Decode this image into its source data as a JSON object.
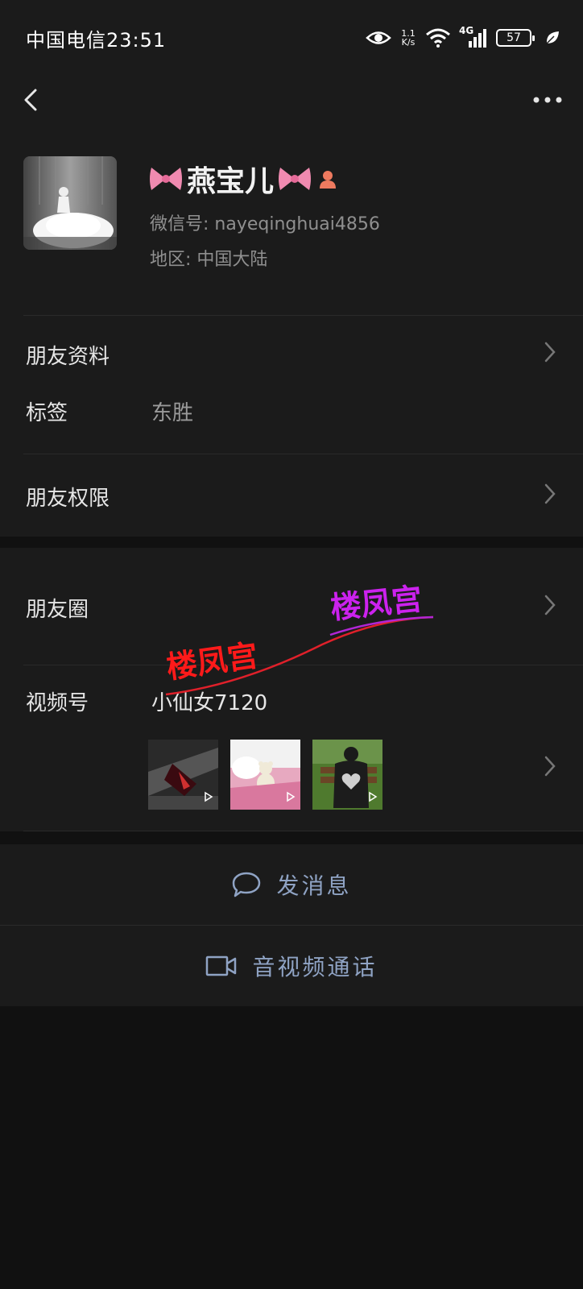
{
  "status_bar": {
    "carrier_time": "中国电信23:51",
    "net_speed_value": "1.1",
    "net_speed_unit": "K/s",
    "network_type": "4G",
    "battery": "57"
  },
  "profile": {
    "name": "燕宝儿",
    "wechat_id": "微信号: nayeqinghuai4856",
    "region": "地区: 中国大陆"
  },
  "rows": {
    "friend_info": "朋友资料",
    "tags_label": "标签",
    "tags_value": "东胜",
    "permissions": "朋友权限",
    "moments": "朋友圈",
    "channels_label": "视频号",
    "channels_value": "小仙女7120"
  },
  "watermark": {
    "text_red": "楼凤宫",
    "text_purple": "楼凤宫",
    "color_red": "#ff1a1a",
    "color_purple": "#cc22ee"
  },
  "actions": {
    "message": "发消息",
    "video_call": "音视频通话"
  },
  "colors": {
    "background": "#111111",
    "surface": "#1b1b1b",
    "link_blue": "#8fa3c4",
    "secondary_text": "#8f8f8f"
  },
  "icons": [
    "back-icon",
    "more-icon",
    "eye-icon",
    "wifi-icon",
    "signal-icon",
    "battery-icon",
    "leaf-icon",
    "bow-icon",
    "gender-female-icon",
    "chevron-right-icon",
    "chat-bubble-icon",
    "video-camera-icon",
    "play-icon"
  ]
}
